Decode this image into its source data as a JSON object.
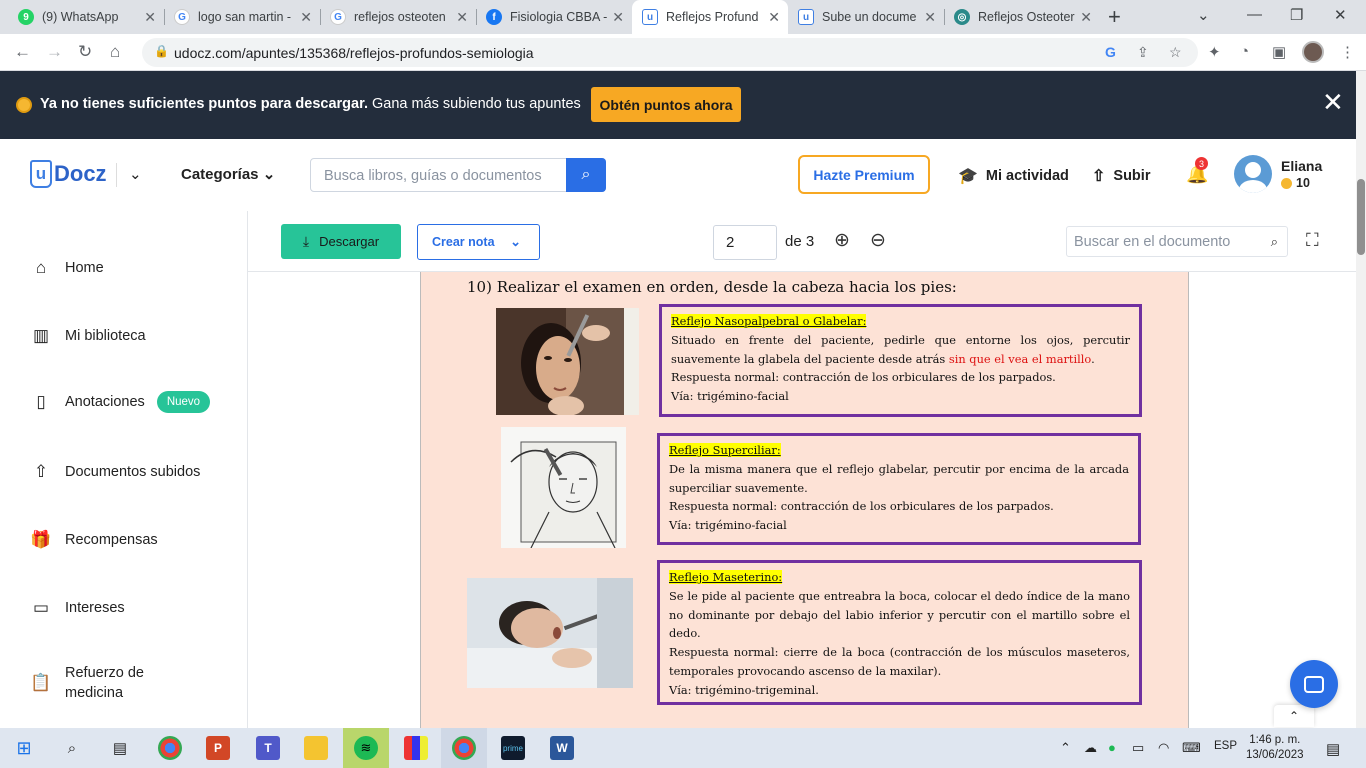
{
  "browser": {
    "tabs": [
      {
        "label": "(9) WhatsApp",
        "icon": "whatsapp-icon",
        "color": "#25d366",
        "glyph": "9"
      },
      {
        "label": "logo san martin -",
        "icon": "google-icon",
        "color": "#4285f4",
        "glyph": "G"
      },
      {
        "label": "reflejos osteoten",
        "icon": "google-icon",
        "color": "#4285f4",
        "glyph": "G"
      },
      {
        "label": "Fisiologia CBBA -",
        "icon": "facebook-icon",
        "color": "#1877f2",
        "glyph": "f"
      },
      {
        "label": "Reflejos Profund",
        "icon": "udocz-icon",
        "color": "#3f7fe3",
        "glyph": "u"
      },
      {
        "label": "Sube un docume",
        "icon": "udocz-icon",
        "color": "#3f7fe3",
        "glyph": "u"
      },
      {
        "label": "Reflejos Osteoter",
        "icon": "globe-icon",
        "color": "#2b8a8a",
        "glyph": "◎"
      }
    ],
    "active_tab": 4,
    "url": "udocz.com/apuntes/135368/reflejos-profundos-semiologia"
  },
  "banner": {
    "bold": "Ya no tienes suficientes puntos para descargar.",
    "text": " Gana más subiendo tus apuntes",
    "cta": "Obtén puntos ahora"
  },
  "header": {
    "logo": "Docz",
    "logo_mark": "u",
    "categories": "Categorías",
    "search_placeholder": "Busca libros, guías o documentos",
    "premium": "Hazte Premium",
    "activity": "Mi actividad",
    "upload": "Subir",
    "notifications": "3",
    "user_name": "Eliana",
    "user_points": "10"
  },
  "sidebar": {
    "items": [
      {
        "label": "Home",
        "icon": "home-icon"
      },
      {
        "label": "Mi biblioteca",
        "icon": "library-icon"
      },
      {
        "label": "Anotaciones",
        "icon": "notes-icon",
        "badge": "Nuevo"
      },
      {
        "label": "Documentos subidos",
        "icon": "upload-icon"
      },
      {
        "label": "Recompensas",
        "icon": "gift-icon"
      },
      {
        "label": "Intereses",
        "icon": "tag-icon"
      },
      {
        "label": "Refuerzo de medicina",
        "icon": "clipboard-icon"
      }
    ]
  },
  "viewer": {
    "download": "Descargar",
    "create_note": "Crear nota",
    "page": "2",
    "page_of": "de 3",
    "doc_search_placeholder": "Buscar en el documento"
  },
  "document": {
    "heading": "10) Realizar el examen en orden, desde la cabeza hacia los pies:",
    "reflexes": [
      {
        "title": "Reflejo Nasopalpebral o Glabelar:",
        "desc": "Situado en frente del paciente, pedirle que entorne los ojos, percutir suavemente la glabela del paciente desde atrás ",
        "desc_red": "sin que el vea el martillo",
        "desc_end": ".",
        "response_label": "Respuesta normal:",
        "response": " contracción de los orbiculares de los parpados.",
        "via": "Vía: trigémino-facial"
      },
      {
        "title": "Reflejo Superciliar:",
        "desc": "De la misma manera que el reflejo glabelar, percutir por encima de la arcada superciliar suavemente.",
        "response_label": "Respuesta normal:",
        "response": " contracción de los orbiculares de los parpados.",
        "via": "Vía: trigémino-facial"
      },
      {
        "title": "Reflejo Maseterino:",
        "desc": "Se le pide al paciente que entreabra la boca, colocar el dedo índice de la mano no dominante por debajo del labio inferior y percutir con el martillo sobre el dedo.",
        "response_label": "Respuesta normal:",
        "response": " cierre de la boca (contracción de los músculos maseteros, temporales provocando ascenso de la maxilar).",
        "via": "Vía: trigémino-trigeminal."
      }
    ]
  },
  "taskbar": {
    "lang": "ESP",
    "time": "1:46 p. m.",
    "date": "13/06/2023"
  },
  "colors": {
    "accent": "#2a6ee5",
    "green": "#27c498",
    "orange": "#f7a823",
    "banner_bg": "#232d3c",
    "doc_bg": "#fde2d6",
    "box_border": "#7030a0"
  }
}
